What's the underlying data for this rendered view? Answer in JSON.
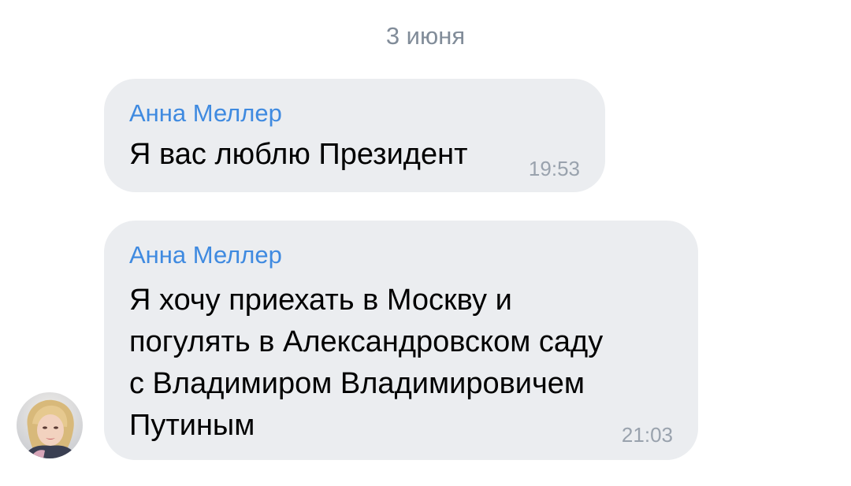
{
  "date_separator": "3 июня",
  "messages": [
    {
      "sender": "Анна Меллер",
      "text": "Я вас люблю Президент",
      "time": "19:53"
    },
    {
      "sender": "Анна Меллер",
      "text": "Я хочу приехать в Москву и\nпогулять в Александровском саду\nс Владимиром Владимировичем\nПутиным",
      "time": "21:03"
    }
  ],
  "avatar": {
    "icon": "user-photo-avatar"
  }
}
